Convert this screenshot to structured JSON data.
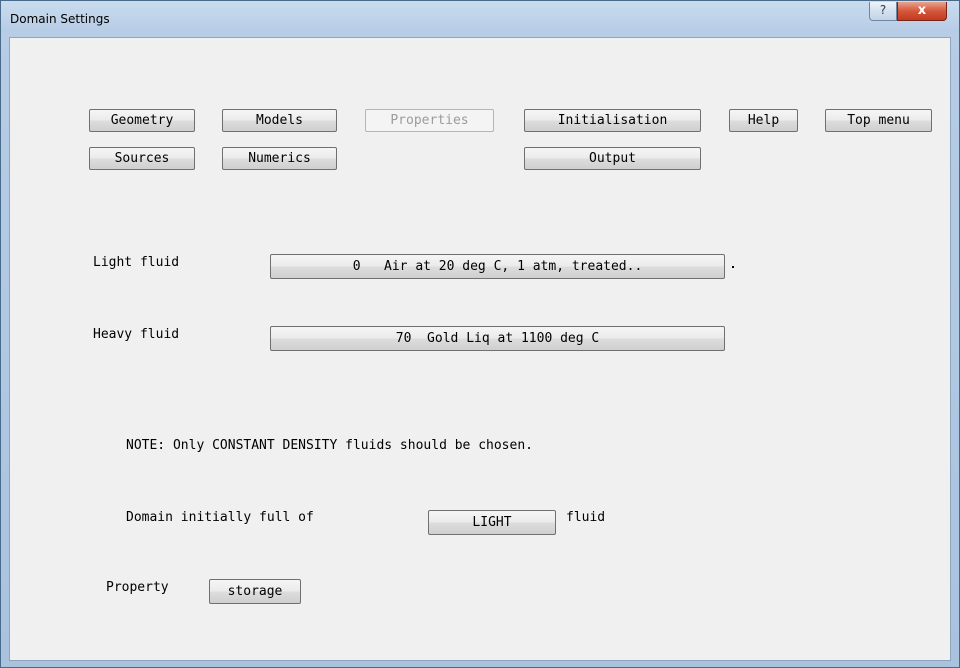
{
  "window": {
    "title": "Domain Settings",
    "help_glyph": "?",
    "close_glyph": "x"
  },
  "menu": {
    "geometry": "Geometry",
    "models": "Models",
    "properties": "Properties",
    "initialisation": "Initialisation",
    "help": "Help",
    "top_menu": "Top menu",
    "sources": "Sources",
    "numerics": "Numerics",
    "output": "Output"
  },
  "light_fluid": {
    "label": "Light fluid",
    "value": "0   Air at 20 deg C, 1 atm, treated.."
  },
  "heavy_fluid": {
    "label": "Heavy fluid",
    "value": "70  Gold Liq at 1100 deg C"
  },
  "note": "NOTE: Only CONSTANT DENSITY fluids should be chosen.",
  "domain_fill": {
    "prefix": "Domain initially full of",
    "value": "LIGHT",
    "suffix": "fluid"
  },
  "property": {
    "label": "Property",
    "value": "storage"
  }
}
